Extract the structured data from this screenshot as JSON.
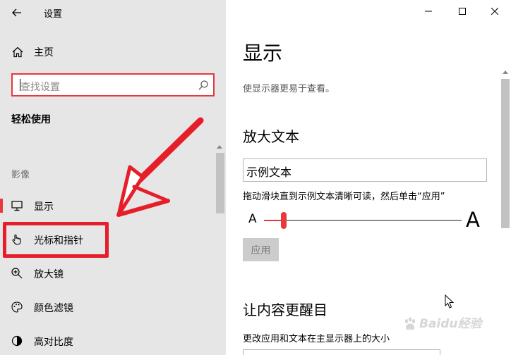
{
  "window": {
    "title": "设置",
    "controls": {
      "minimize": "minimize-icon",
      "maximize": "maximize-icon",
      "close": "close-icon"
    }
  },
  "sidebar": {
    "home_label": "主页",
    "search_placeholder": "查找设置",
    "section_heading": "轻松使用",
    "group_label": "影像",
    "items": [
      {
        "label": "显示",
        "icon": "monitor-icon",
        "selected": true
      },
      {
        "label": "光标和指针",
        "icon": "pointer-hand-icon",
        "selected": false
      },
      {
        "label": "放大镜",
        "icon": "magnifier-icon",
        "selected": false
      },
      {
        "label": "颜色滤镜",
        "icon": "palette-icon",
        "selected": false
      },
      {
        "label": "高对比度",
        "icon": "contrast-icon",
        "selected": false
      }
    ]
  },
  "main": {
    "title": "显示",
    "subtitle": "使显示器更易于查看。",
    "enlarge_text": {
      "heading": "放大文本",
      "sample_text": "示例文本",
      "instruction": "拖动滑块直到示例文本清晰可读，然后单击“应用”",
      "small_a": "A",
      "large_a": "A",
      "slider_value_fraction": 0.1,
      "apply_label": "应用"
    },
    "bright": {
      "heading": "让内容更醒目",
      "hint": "更改应用和文本在主显示器上的大小"
    }
  },
  "watermark": "Baidu经验",
  "colors": {
    "accent": "#e8373d",
    "annotation_red": "#e61e29",
    "sidebar_bg": "#e6e6e6"
  }
}
